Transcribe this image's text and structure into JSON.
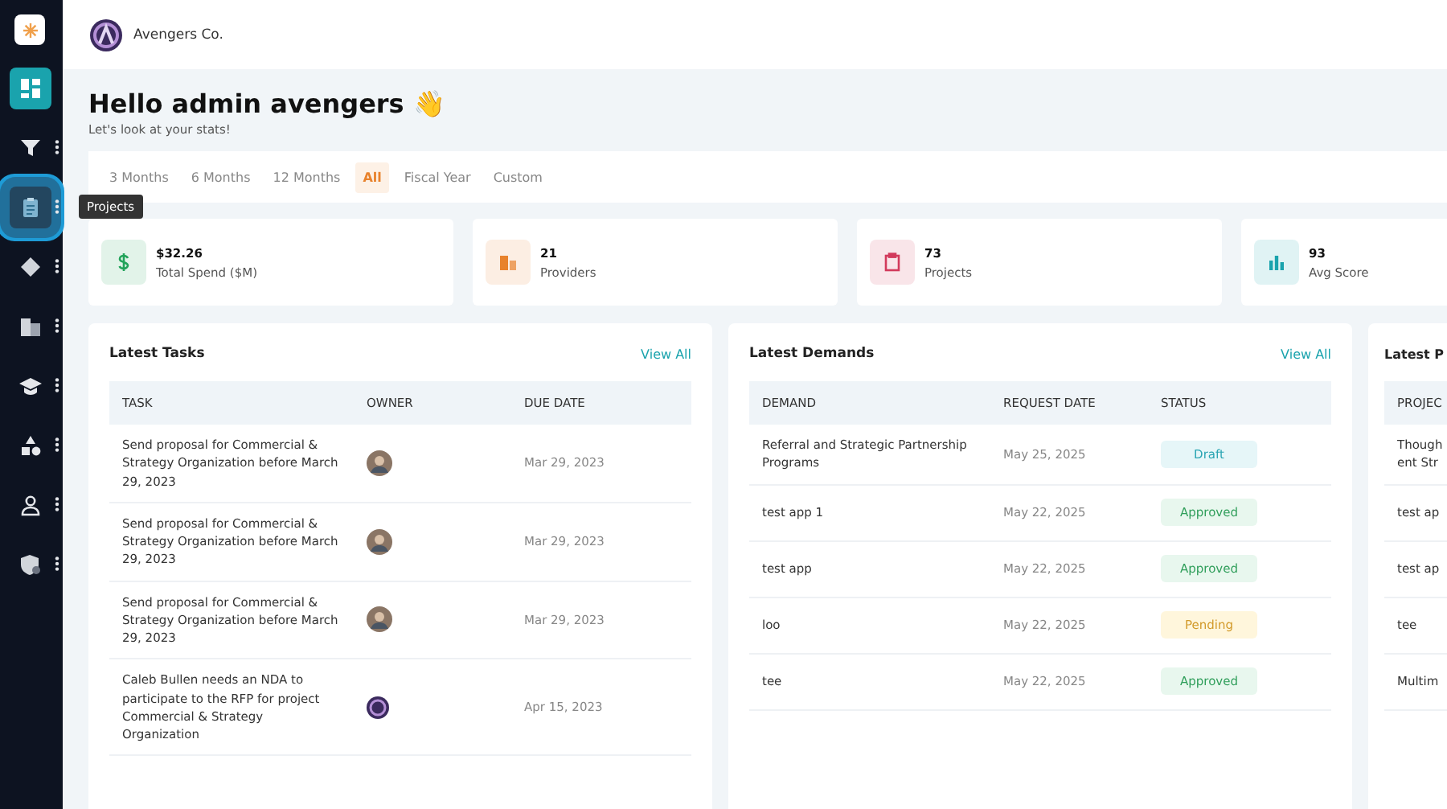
{
  "sidebar": {
    "items": [
      {
        "selected": true
      },
      {
        "selected": false
      },
      {
        "selected": false,
        "tooltip": "Projects"
      },
      {
        "selected": false
      },
      {
        "selected": false
      },
      {
        "selected": false
      },
      {
        "selected": false
      },
      {
        "selected": false
      },
      {
        "selected": false
      }
    ]
  },
  "header": {
    "company": "Avengers Co."
  },
  "greeting": {
    "title": "Hello admin avengers",
    "emoji": "👋",
    "subtitle": "Let's look at your stats!"
  },
  "periods": [
    {
      "label": "3 Months",
      "selected": false
    },
    {
      "label": "6 Months",
      "selected": false
    },
    {
      "label": "12 Months",
      "selected": false
    },
    {
      "label": "All",
      "selected": true
    },
    {
      "label": "Fiscal Year",
      "selected": false
    },
    {
      "label": "Custom",
      "selected": false
    }
  ],
  "stats": [
    {
      "value": "$32.26",
      "label": "Total Spend ($M)",
      "color": "#22a35a"
    },
    {
      "value": "21",
      "label": "Providers",
      "color": "#e8822c"
    },
    {
      "value": "73",
      "label": "Projects",
      "color": "#d23a5c"
    },
    {
      "value": "93",
      "label": "Avg Score",
      "color": "#1aa3ad"
    }
  ],
  "tasks": {
    "title": "Latest Tasks",
    "link": "View All",
    "columns": [
      "TASK",
      "OWNER",
      "DUE DATE"
    ],
    "rows": [
      {
        "task": "Send proposal for Commercial & Strategy Organization before March 29, 2023",
        "kind": "person",
        "due": "Mar 29, 2023"
      },
      {
        "task": "Send proposal for Commercial & Strategy Organization before March 29, 2023",
        "kind": "person",
        "due": "Mar 29, 2023"
      },
      {
        "task": "Send proposal for Commercial & Strategy Organization before March 29, 2023",
        "kind": "person",
        "due": "Mar 29, 2023"
      },
      {
        "task": "Caleb Bullen needs an NDA to participate to the RFP for project Commercial & Strategy Organization",
        "kind": "logo",
        "due": "Apr 15, 2023"
      }
    ]
  },
  "demands": {
    "title": "Latest Demands",
    "link": "View All",
    "columns": [
      "DEMAND",
      "REQUEST DATE",
      "STATUS"
    ],
    "rows": [
      {
        "demand": "Referral and Strategic Partnership Programs",
        "date": "May 25, 2025",
        "status": "Draft",
        "kind": "info"
      },
      {
        "demand": "test app 1",
        "date": "May 22, 2025",
        "status": "Approved",
        "kind": "success"
      },
      {
        "demand": "test app",
        "date": "May 22, 2025",
        "status": "Approved",
        "kind": "success"
      },
      {
        "demand": "loo",
        "date": "May 22, 2025",
        "status": "Pending",
        "kind": "warning"
      },
      {
        "demand": "tee",
        "date": "May 22, 2025",
        "status": "Approved",
        "kind": "success"
      }
    ]
  },
  "projects_panel": {
    "title": "Latest P",
    "column_1": "PROJEC",
    "rows": [
      "Though\nent Str",
      "test ap",
      "test ap",
      "tee",
      "Multim"
    ]
  }
}
